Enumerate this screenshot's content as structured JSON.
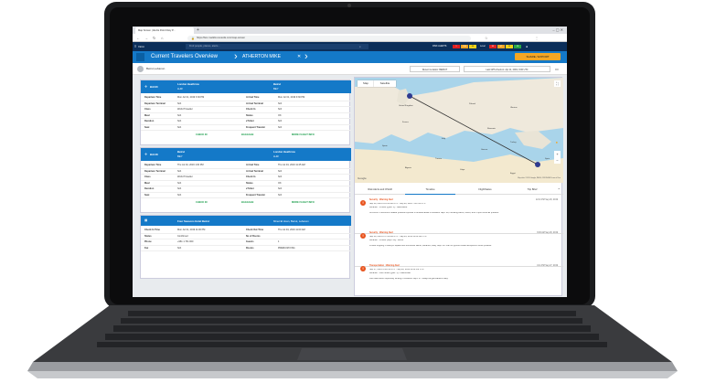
{
  "browser": {
    "tab_title": "Map Screen | Alertis Point Disty P...",
    "url": "https://box.marklix-nexsolis.com/map-screen",
    "bookmarks_label": "Other bookmarks"
  },
  "app": {
    "logo_text": "Viron",
    "search_placeholder": "Find people, places, alerts...",
    "risk_label": "RISK ALERTS",
    "risk_counts": [
      "1",
      "196",
      "44"
    ],
    "level_label": "Level",
    "level_counts": [
      "93",
      "47",
      "11",
      "19"
    ],
    "colors": {
      "header": "#0b2e59",
      "crumb": "#1479c8",
      "risk_red": "#e02020",
      "risk_orange": "#f5a623",
      "risk_yellow": "#f0d21a",
      "level_green": "#29a745",
      "alert_orange": "#e8541e"
    }
  },
  "breadcrumb": {
    "item1": "Current Travelers Overview",
    "item2": "ATHERTON MIKE",
    "share_label": "SHARE / EXPORT"
  },
  "subbar": {
    "traveler_name": "Beirut,Lebanon",
    "recent_location": "Recent Location: BEIRUT",
    "last_gps": "Last GPS check-in: Apr 11, 2019, 9:00 UTC"
  },
  "flight1": {
    "from": "BA100",
    "from_city": "London Heathrow",
    "from_code": "LHR",
    "to_city": "Beirut",
    "to_code": "BEY",
    "rows": [
      [
        "Departure Time",
        "Mon Jul 01, 2019 3:30 PM",
        "Arrival Time",
        "Mon Jul 01, 2019 9:30 PM"
      ],
      [
        "Departure Terminal",
        "N/A",
        "Arrival Terminal",
        "N/A"
      ],
      [
        "Class",
        "World Traveller",
        "Check In",
        "N/A"
      ],
      [
        "Meal",
        "N/A",
        "Status",
        "OK"
      ],
      [
        "Duration",
        "N/A",
        "eTicket",
        "N/A"
      ],
      [
        "Seat",
        "N/A",
        "Frequent Traveler",
        "N/A"
      ]
    ],
    "check_in": "CHECK IN",
    "baggage": "BAGGAGE",
    "more": "MORE FLIGHT INFO"
  },
  "flight2": {
    "from": "BA148",
    "from_city": "Beirut",
    "from_code": "BEY",
    "to_city": "London Heathrow",
    "to_code": "LHR",
    "rows": [
      [
        "Departure Time",
        "Thu Jul 04, 2019 1:00 PM",
        "Arrival Time",
        "Thu Jul 04, 2019 11:25 AM"
      ],
      [
        "Departure Terminal",
        "N/A",
        "Arrival Terminal",
        "N/A"
      ],
      [
        "Class",
        "World Traveller",
        "Check In",
        "N/A"
      ],
      [
        "Meal",
        "N/A",
        "Status",
        "OK"
      ],
      [
        "Duration",
        "N/A",
        "eTicket",
        "N/A"
      ],
      [
        "Seat",
        "N/A",
        "Frequent Traveler",
        "N/A"
      ]
    ],
    "check_in": "CHECK IN",
    "baggage": "BAGGAGE",
    "more": "MORE FLIGHT INFO"
  },
  "hotel": {
    "name": "Four Seasons Hotel Beirut",
    "address": "Minet El Hosn, Beirut, Lebanon",
    "rows": [
      [
        "Check In Time",
        "Mon Jul 01, 2019 11:00 PM",
        "Check Out Time",
        "Thu Jul 04, 2019 11:00 AM"
      ],
      [
        "Status",
        "Confirmed",
        "No of Rooms",
        ""
      ],
      [
        "Phone",
        "+961 1 761 000",
        "Guests",
        "1"
      ],
      [
        "Fax",
        "N/A",
        "Rooms",
        "PREMIUM KING"
      ]
    ]
  },
  "map": {
    "btn_map": "Map",
    "btn_satellite": "Satellite",
    "labels": [
      "United Kingdom",
      "France",
      "Spain",
      "Italy",
      "Greece",
      "Turkey",
      "Syria",
      "Egypt",
      "Libya",
      "Algeria",
      "Tunisia",
      "Ukraine",
      "Poland",
      "Romania"
    ],
    "google": "Google",
    "attribution": "Map data ©2019 Google, INEGI, ORION-ME   Terms of Use"
  },
  "panel_tabs": [
    "Risk Alerts and OSAR",
    "Timeline",
    "FlightStatus",
    "Trip Brief"
  ],
  "alerts": [
    {
      "title": "Security : Warning Alert",
      "time": "12:21 PM Sep 26, 2019",
      "lines": [
        "Sep 26, 2019 9:11:56 AM UTC - Sep 26, 2019 7:00 PM UTC",
        "Lebanon - Protest (Q&A: 1) - Nationwide",
        "UPDATE 1: Economic-related protests reported in several areas of Lebanon Sept. 29, including Beirut, Sidon, and Tripoli. Avoid all protests."
      ]
    },
    {
      "title": "Security : Warning Alert",
      "time": "9:00 AM Sep 26, 2019",
      "lines": [
        "Sep 26, 2019 8:37:43 AM UTC - Sep 26, 2019 11:00 AM UTC",
        "Lebanon - Protest (Sept. 29) - Beirut",
        "Protest ongoing in Martyrs Square and surrounds Beirut, Lebanon, early Sept. 29. Plan for ground travel disruptions. Avoid protests."
      ]
    },
    {
      "title": "Transportation : Warning Alert",
      "time": "4:41 PM Sep 27, 2019",
      "lines": [
        "Sep 27, 2019 4:44 PM UTC - Sep 28, 2019 11:00 PM UTC",
        "Lebanon - Fuel Strike (Q&A: 1) - Nationwide",
        "Fuel distributors reportedly striking in Lebanon Sept. 27. Delays at gas stations likely."
      ]
    }
  ]
}
